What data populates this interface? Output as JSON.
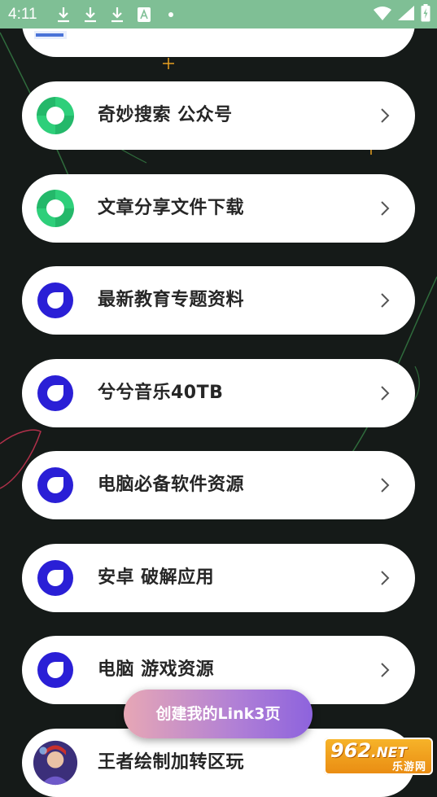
{
  "status_bar": {
    "time": "4:11",
    "left_icons": [
      "download-icon",
      "download-icon",
      "download-icon",
      "translate-icon",
      "dot-icon"
    ],
    "right_icons": [
      "wifi-icon",
      "signal-icon",
      "battery-icon"
    ]
  },
  "items": [
    {
      "label": "",
      "icon": "chatgpt-logo-icon"
    },
    {
      "label": "奇妙搜索 公众号",
      "icon": "green-swirl-icon"
    },
    {
      "label": "文章分享文件下载",
      "icon": "green-swirl-icon"
    },
    {
      "label": "最新教育专题资料",
      "icon": "blue-ring-icon"
    },
    {
      "label": "兮兮音乐40TB",
      "icon": "blue-ring-icon"
    },
    {
      "label": "电脑必备软件资源",
      "icon": "blue-ring-icon"
    },
    {
      "label": "安卓  破解应用",
      "icon": "blue-ring-icon"
    },
    {
      "label": "电脑  游戏资源",
      "icon": "blue-ring-icon"
    },
    {
      "label": "王者绘制加转区玩",
      "icon": "avatar-icon"
    }
  ],
  "cta": {
    "label": "创建我的Link3页"
  },
  "watermark": {
    "number": "962",
    "suffix": ".NET",
    "site": "乐游网"
  },
  "colors": {
    "background": "#151a18",
    "status_bar": "#7fbf95",
    "green_icon": "#2ecf7a",
    "blue_icon": "#2a1fd6",
    "cta_start": "#e7a7b5",
    "cta_end": "#8d63dd"
  }
}
